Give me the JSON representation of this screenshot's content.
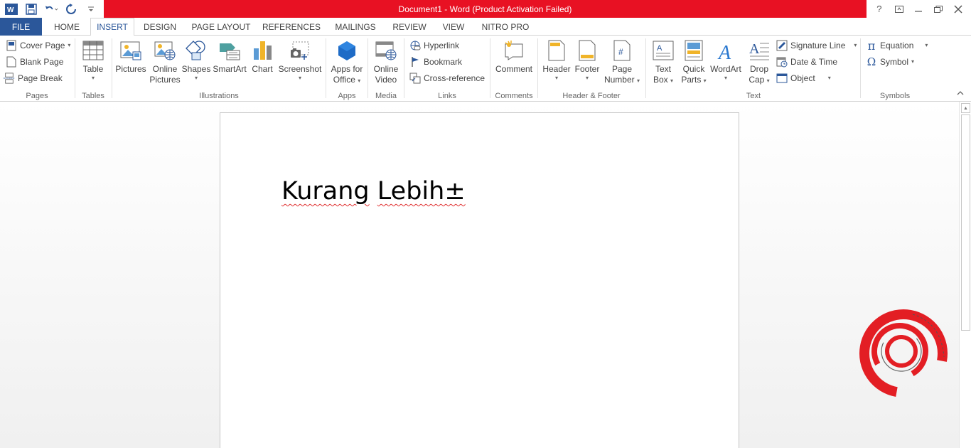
{
  "window": {
    "title": "Document1 -  Word (Product Activation Failed)",
    "controls": [
      "?",
      "restore",
      "minimize",
      "maximize",
      "close"
    ]
  },
  "tabs": [
    {
      "label": "FILE"
    },
    {
      "label": "HOME"
    },
    {
      "label": "INSERT"
    },
    {
      "label": "DESIGN"
    },
    {
      "label": "PAGE LAYOUT"
    },
    {
      "label": "REFERENCES"
    },
    {
      "label": "MAILINGS"
    },
    {
      "label": "REVIEW"
    },
    {
      "label": "VIEW"
    },
    {
      "label": "NITRO PRO"
    }
  ],
  "ribbon": {
    "pages": {
      "label": "Pages",
      "cover_page": "Cover Page",
      "blank_page": "Blank Page",
      "page_break": "Page Break"
    },
    "tables": {
      "label": "Tables",
      "table": "Table"
    },
    "illustrations": {
      "label": "Illustrations",
      "pictures": "Pictures",
      "online_pictures_1": "Online",
      "online_pictures_2": "Pictures",
      "shapes": "Shapes",
      "smartart": "SmartArt",
      "chart": "Chart",
      "screenshot": "Screenshot"
    },
    "apps": {
      "label": "Apps",
      "apps_1": "Apps for",
      "apps_2": "Office"
    },
    "media": {
      "label": "Media",
      "video_1": "Online",
      "video_2": "Video"
    },
    "links": {
      "label": "Links",
      "hyperlink": "Hyperlink",
      "bookmark": "Bookmark",
      "cross_reference": "Cross-reference"
    },
    "comments": {
      "label": "Comments",
      "comment": "Comment"
    },
    "header_footer": {
      "label": "Header & Footer",
      "header": "Header",
      "footer": "Footer",
      "page_number_1": "Page",
      "page_number_2": "Number"
    },
    "text": {
      "label": "Text",
      "text_box_1": "Text",
      "text_box_2": "Box",
      "quick_parts_1": "Quick",
      "quick_parts_2": "Parts",
      "wordart": "WordArt",
      "drop_cap_1": "Drop",
      "drop_cap_2": "Cap",
      "signature_line": "Signature Line",
      "date_time": "Date & Time",
      "object": "Object"
    },
    "symbols": {
      "label": "Symbols",
      "equation": "Equation",
      "symbol": "Symbol"
    }
  },
  "document": {
    "word1": "Kurang",
    "word2": "Lebih±"
  },
  "colors": {
    "title_bar": "#e81123",
    "file_tab": "#2b579a",
    "logo_red": "#e31e24"
  }
}
